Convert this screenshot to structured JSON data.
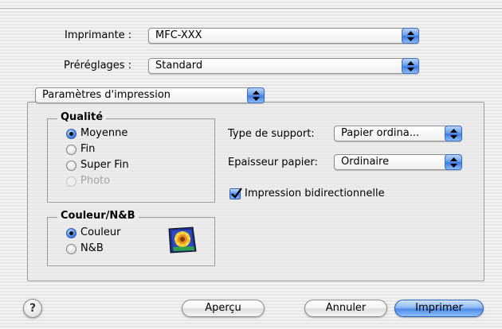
{
  "printer": {
    "label": "Imprimante :",
    "value": "MFC-XXX"
  },
  "presets": {
    "label": "Préréglages :",
    "value": "Standard"
  },
  "panel_selector": {
    "value": "Paramètres d'impression"
  },
  "quality": {
    "title": "Qualité",
    "options": [
      {
        "label": "Moyenne",
        "selected": true,
        "disabled": false
      },
      {
        "label": "Fin",
        "selected": false,
        "disabled": false
      },
      {
        "label": "Super Fin",
        "selected": false,
        "disabled": false
      },
      {
        "label": "Photo",
        "selected": false,
        "disabled": true
      }
    ]
  },
  "color": {
    "title": "Couleur/N&B",
    "options": [
      {
        "label": "Couleur",
        "selected": true
      },
      {
        "label": "N&B",
        "selected": false
      }
    ],
    "icon": "color-printing-icon"
  },
  "media": {
    "label": "Type de support:",
    "value": "Papier ordina..."
  },
  "thickness": {
    "label": "Epaisseur papier:",
    "value": "Ordinaire"
  },
  "bidirectional": {
    "label": "Impression bidirectionnelle",
    "checked": true
  },
  "buttons": {
    "preview": "Aperçu",
    "cancel": "Annuler",
    "print": "Imprimer",
    "help": "?"
  },
  "colors": {
    "accent": "#4a86e8",
    "window_bg": "#ececec"
  }
}
